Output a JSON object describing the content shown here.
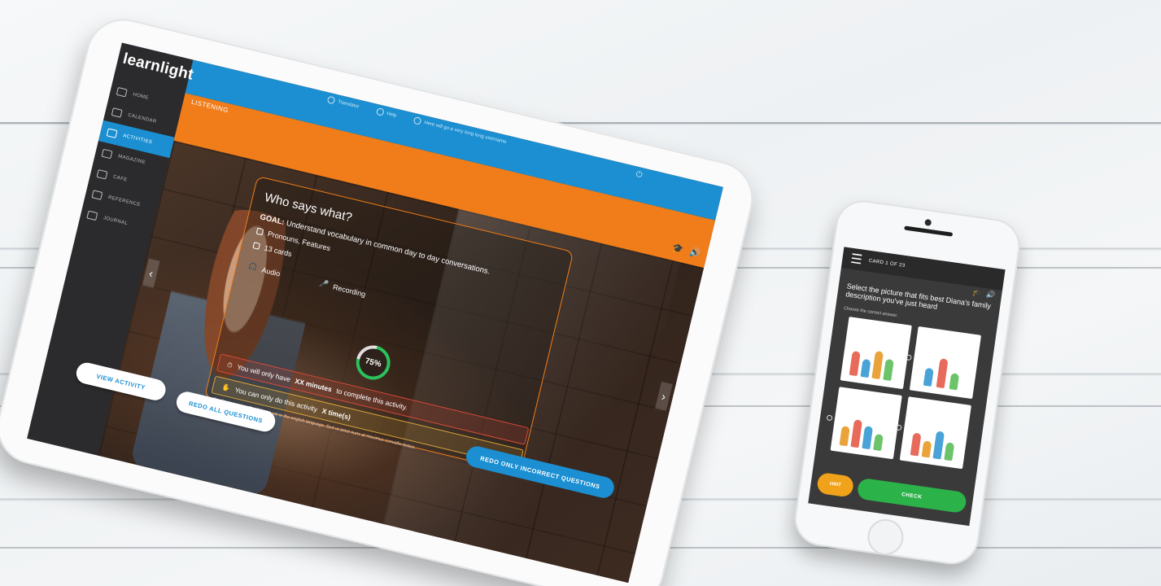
{
  "tablet": {
    "brand": "learnlight",
    "nav": [
      {
        "label": "HOME",
        "active": false
      },
      {
        "label": "CALENDAR",
        "active": false
      },
      {
        "label": "ACTIVITIES",
        "active": true
      },
      {
        "label": "MAGAZINE",
        "active": false
      },
      {
        "label": "CAFE",
        "active": false
      },
      {
        "label": "REFERENCE",
        "active": false
      },
      {
        "label": "JOURNAL",
        "active": false
      }
    ],
    "section_title": "LISTENING",
    "tools": {
      "translator": "Translator",
      "help": "Help",
      "username": "Here will go a very long long username"
    },
    "card": {
      "title": "Who says what?",
      "goal_label": "GOAL:",
      "goal_text": "Understand vocabulary in common day to day conversations.",
      "topics": "Pronouns, Features",
      "cards": "13 cards",
      "audio": "Audio",
      "recording": "Recording",
      "progress_label": "75%",
      "progress": 0.75,
      "warning1_pre": "You will only have",
      "warning1_bold": "XX minutes",
      "warning1_post": "to complete this activity.",
      "warning2_pre": "You can only do this activity",
      "warning2_bold": "X time(s)",
      "credits": "Credited sources: Curabitur at vel in the english language. Sed ut amet nunc at maximus convallis lectus."
    },
    "buttons": {
      "view": "VIEW ACTIVITY",
      "redo_all": "REDO ALL QUESTIONS",
      "redo_incorrect": "REDO ONLY INCORRECT QUESTIONS"
    }
  },
  "phone": {
    "card_counter": "CARD 1 OF 23",
    "question": "Select the picture that fits best Diana's family description you've just heard",
    "instruction": "Choose the correct answer.",
    "hint": "HINT",
    "check": "CHECK"
  },
  "colors": {
    "blue": "#1b8fd1",
    "orange": "#f07d19",
    "green": "#2bb34a",
    "hint_yellow": "#f0a21a"
  }
}
